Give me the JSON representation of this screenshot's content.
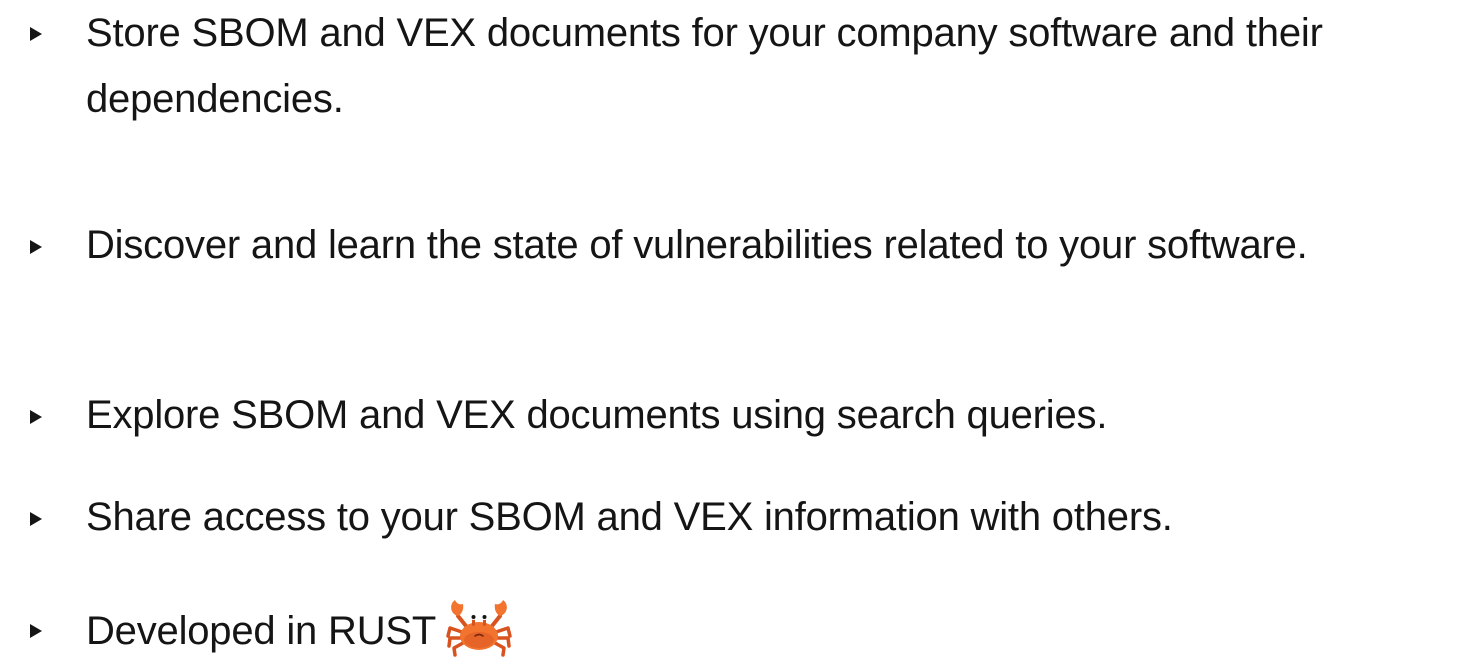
{
  "bullets": [
    {
      "text": "Store SBOM and VEX documents for your company software and their dependencies."
    },
    {
      "text": "Discover and learn the state of vulnerabilities related to your software."
    },
    {
      "text": "Explore SBOM and VEX documents using search queries."
    },
    {
      "text": "Share access to your SBOM and VEX information with others."
    },
    {
      "text": "Developed in RUST",
      "icon": "crab-icon"
    }
  ],
  "colors": {
    "text": "#151515",
    "background": "#ffffff",
    "crab_body": "#f2742e",
    "crab_shade": "#d8531f"
  }
}
